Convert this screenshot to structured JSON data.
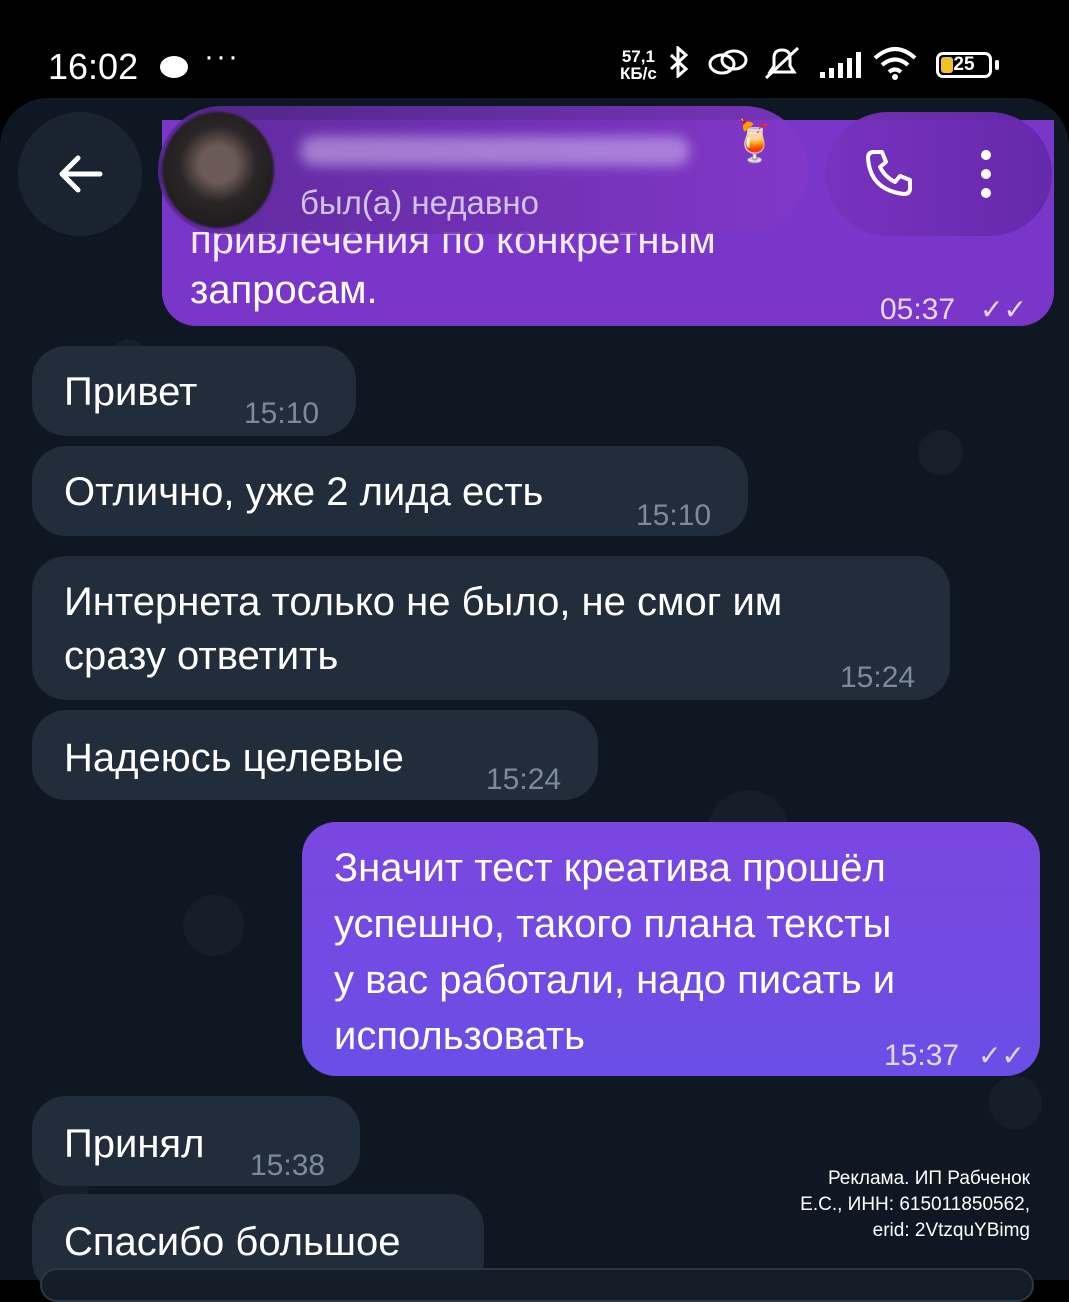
{
  "status_bar": {
    "time": "16:02",
    "dots": "···",
    "speed_top": "57,1",
    "speed_bottom": "КБ/с",
    "battery": "25"
  },
  "header": {
    "last_seen": "был(а) недавно",
    "emoji": "🍹"
  },
  "messages": [
    {
      "dir": "out",
      "text_partial": "привлечения по конкретным",
      "text": "запросам.",
      "time": "05:37",
      "read": "✓✓"
    },
    {
      "dir": "in",
      "text": "Привет",
      "time": "15:10"
    },
    {
      "dir": "in",
      "text": "Отлично, уже 2 лида есть",
      "time": "15:10"
    },
    {
      "dir": "in",
      "text_line1": "Интернета только не было, не смог им",
      "text_line2": "сразу ответить",
      "time": "15:24"
    },
    {
      "dir": "in",
      "text": "Надеюсь целевые",
      "time": "15:24"
    },
    {
      "dir": "out",
      "lines": [
        "Значит тест креатива прошёл",
        "успешно, такого плана тексты",
        "у вас работали, надо писать и",
        "использовать"
      ],
      "time": "15:37",
      "read": "✓✓"
    },
    {
      "dir": "in",
      "text": "Принял",
      "time": "15:38"
    },
    {
      "dir": "in",
      "text": "Спасибо большое"
    }
  ],
  "ad_note": {
    "line1": "Реклама. ИП Рабченок",
    "line2": "Е.С., ИНН: 615011850562,",
    "line3": "erid: 2VtzquYBimg"
  },
  "colors": {
    "incoming_bubble": "#212d3b",
    "outgoing_bubble": "#6a4fe6",
    "chat_background": "#0f1722"
  }
}
